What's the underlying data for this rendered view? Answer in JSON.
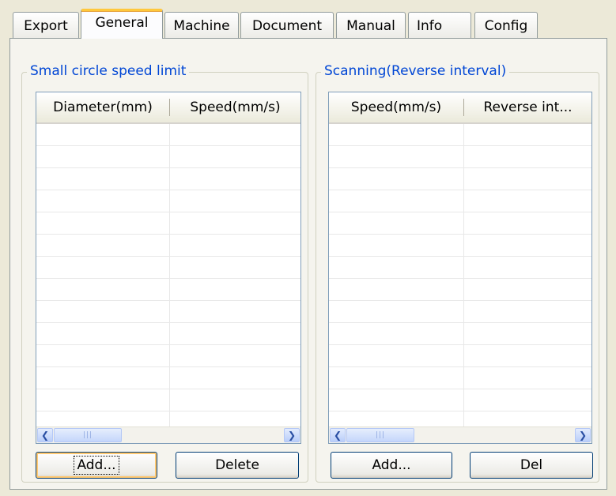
{
  "tabs": [
    {
      "label": "Export",
      "active": false
    },
    {
      "label": "General",
      "active": true
    },
    {
      "label": "Machine",
      "active": false
    },
    {
      "label": "Document",
      "active": false
    },
    {
      "label": "Manual",
      "active": false
    },
    {
      "label": "Info",
      "active": false
    },
    {
      "label": "Config",
      "active": false
    }
  ],
  "small_circle": {
    "title": "Small circle speed limit",
    "columns": [
      "Diameter(mm)",
      "Speed(mm/s)"
    ],
    "rows": [],
    "add_label": "Add...",
    "delete_label": "Delete"
  },
  "scanning": {
    "title": "Scanning(Reverse interval)",
    "columns": [
      "Speed(mm/s)",
      "Reverse int..."
    ],
    "rows": [],
    "add_label": "Add...",
    "delete_label": "Del"
  },
  "icons": {
    "scroll_left": "chevron-left-icon",
    "scroll_right": "chevron-right-icon"
  },
  "colors": {
    "group_title": "#0046d5",
    "active_tab_accent": "#ffc83c",
    "window_bg": "#ece9d8"
  }
}
